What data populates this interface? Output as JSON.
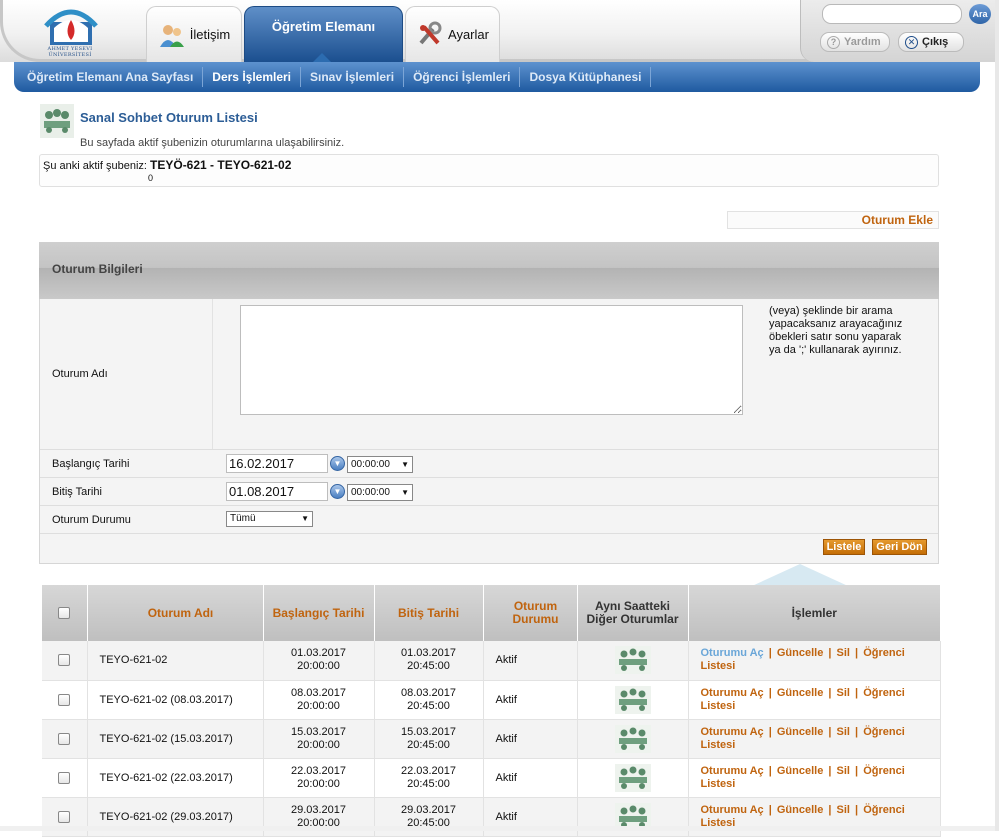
{
  "header": {
    "logo_text": "AHMET YESEVI ÜNİVERSİTESİ",
    "tabs": [
      {
        "label": "İletişim"
      },
      {
        "label": "Öğretim Elemanı"
      },
      {
        "label": "Ayarlar"
      }
    ],
    "search": {
      "placeholder": "",
      "button_label": "Ara"
    },
    "help_label": "Yardım",
    "logout_label": "Çıkış"
  },
  "nav": {
    "items": [
      {
        "label": "Öğretim Elemanı Ana Sayfası"
      },
      {
        "label": "Ders İşlemleri"
      },
      {
        "label": "Sınav İşlemleri"
      },
      {
        "label": "Öğrenci İşlemleri"
      },
      {
        "label": "Dosya Kütüphanesi"
      }
    ]
  },
  "page": {
    "title": "Sanal Sohbet Oturum Listesi",
    "description": "Bu sayfada aktif şubenizin oturumlarına ulaşabilirsiniz.",
    "active_branch_label": "Şu anki aktif şubeniz:",
    "active_branch_value": "TEYÖ-621 - TEYO-621-02",
    "active_branch_extra": "0",
    "add_session_label": "Oturum Ekle"
  },
  "form": {
    "panel_title": "Oturum Bilgileri",
    "name_label": "Oturum Adı",
    "name_value": "",
    "hint": "(veya) şeklinde bir arama yapacaksanız arayacağınız öbekleri satır sonu yaparak ya da ';' kullanarak ayırınız.",
    "start_label": "Başlangıç Tarihi",
    "start_date": "16.02.2017",
    "start_time": "00:00:00",
    "end_label": "Bitiş Tarihi",
    "end_date": "01.08.2017",
    "end_time": "00:00:00",
    "status_label": "Oturum Durumu",
    "status_value": "Tümü",
    "list_button": "Listele",
    "back_button": "Geri Dön"
  },
  "table": {
    "headers": {
      "name": "Oturum Adı",
      "start": "Başlangıç Tarihi",
      "end": "Bitiş Tarihi",
      "status": "Oturum Durumu",
      "other": "Aynı Saatteki Diğer Oturumlar",
      "ops": "İşlemler"
    },
    "op_labels": {
      "open": "Oturumu Aç",
      "update": "Güncelle",
      "delete": "Sil",
      "students": "Öğrenci Listesi"
    },
    "rows": [
      {
        "name": "TEYO-621-02",
        "start_date": "01.03.2017",
        "start_time": "20:00:00",
        "end_date": "01.03.2017",
        "end_time": "20:45:00",
        "status": "Aktif"
      },
      {
        "name": "TEYO-621-02 (08.03.2017)",
        "start_date": "08.03.2017",
        "start_time": "20:00:00",
        "end_date": "08.03.2017",
        "end_time": "20:45:00",
        "status": "Aktif"
      },
      {
        "name": "TEYO-621-02 (15.03.2017)",
        "start_date": "15.03.2017",
        "start_time": "20:00:00",
        "end_date": "15.03.2017",
        "end_time": "20:45:00",
        "status": "Aktif"
      },
      {
        "name": "TEYO-621-02 (22.03.2017)",
        "start_date": "22.03.2017",
        "start_time": "20:00:00",
        "end_date": "22.03.2017",
        "end_time": "20:45:00",
        "status": "Aktif"
      },
      {
        "name": "TEYO-621-02 (29.03.2017)",
        "start_date": "29.03.2017",
        "start_time": "20:00:00",
        "end_date": "29.03.2017",
        "end_time": "20:45:00",
        "status": "Aktif"
      }
    ]
  },
  "colors": {
    "accent_blue": "#1f5aa0",
    "link_orange": "#c0640f",
    "visited_link": "#6aa6d8"
  }
}
